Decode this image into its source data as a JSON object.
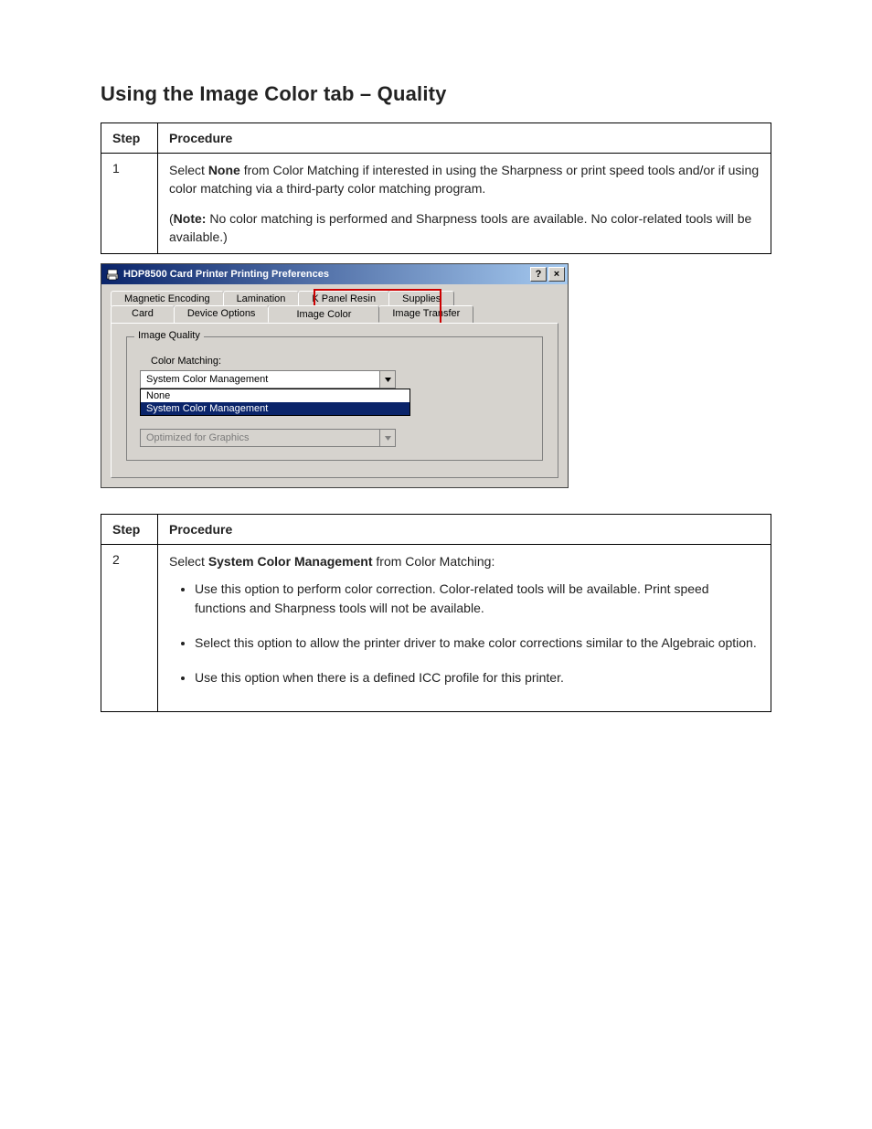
{
  "section_title": "Using the Image Color tab – Quality",
  "table1": {
    "header_step": "Step",
    "header_proc": "Procedure",
    "row_step": "1",
    "row_proc_lead": "Select ",
    "row_proc_bold": "None",
    "row_proc_tail": " from Color Matching if interested in using the Sharpness or print speed tools and/or if using color matching via a third-party color matching program.",
    "row_proc_note_parens": "(",
    "row_proc_note_bold": "Note:",
    "row_proc_note_text": " No color matching is performed and Sharpness tools are available. No color-related tools will be available.)"
  },
  "dialog": {
    "title": "HDP8500 Card Printer Printing Preferences",
    "help_label": "?",
    "close_label": "×",
    "tabs_row1": [
      "Magnetic Encoding",
      "Lamination",
      "K Panel Resin",
      "Supplies"
    ],
    "tabs_row2": [
      "Card",
      "Device Options",
      "Image Color",
      "Image Transfer"
    ],
    "selected_tab": "Image Color",
    "groupbox_label": "Image Quality",
    "color_matching_label": "Color Matching:",
    "color_matching_value": "System Color Management",
    "dropdown_options": [
      "None",
      "System Color Management"
    ],
    "dropdown_selected": "System Color Management",
    "second_combo_value": "Optimized for Graphics"
  },
  "table2": {
    "header_step": "Step",
    "header_proc": "Procedure",
    "row_step": "2",
    "row_proc_lead1": "Select ",
    "row_proc_bold1": "System Color Management",
    "row_proc_tail1": " from Color Matching:",
    "bullets": [
      "Use this option to perform color correction. Color-related tools will be available. Print speed functions and Sharpness tools will not be available.",
      "Select this option to allow the printer driver to make color corrections similar to the Algebraic option.",
      "Use this option when there is a defined ICC profile for this printer."
    ]
  }
}
